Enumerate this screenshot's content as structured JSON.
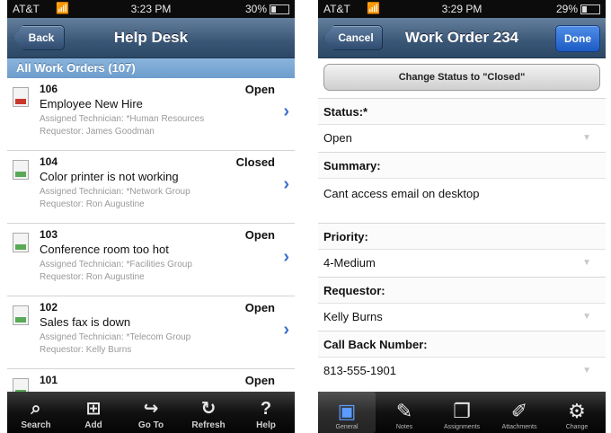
{
  "left": {
    "statusbar": {
      "carrier": "AT&T",
      "time": "3:23 PM",
      "battery": "30%"
    },
    "navbar": {
      "back": "Back",
      "title": "Help Desk"
    },
    "section": "All Work Orders (107)",
    "rows": [
      {
        "num": "106",
        "status": "Open",
        "summary": "Employee New Hire",
        "tech": "Assigned Technician: *Human Resources",
        "req": "Requestor: James Goodman"
      },
      {
        "num": "104",
        "status": "Closed",
        "summary": "Color printer is not working",
        "tech": "Assigned Technician: *Network Group",
        "req": "Requestor: Ron Augustine"
      },
      {
        "num": "103",
        "status": "Open",
        "summary": "Conference room too hot",
        "tech": "Assigned Technician: *Facilities Group",
        "req": "Requestor: Ron Augustine"
      },
      {
        "num": "102",
        "status": "Open",
        "summary": "Sales fax is down",
        "tech": "Assigned Technician: *Telecom Group",
        "req": "Requestor: Kelly Burns"
      },
      {
        "num": "101",
        "status": "Open",
        "summary": "",
        "tech": "",
        "req": ""
      }
    ],
    "tabs": [
      {
        "label": "Search",
        "icon": "search-icon"
      },
      {
        "label": "Add",
        "icon": "add-icon"
      },
      {
        "label": "Go To",
        "icon": "goto-icon"
      },
      {
        "label": "Refresh",
        "icon": "refresh-icon"
      },
      {
        "label": "Help",
        "icon": "help-icon"
      }
    ]
  },
  "right": {
    "statusbar": {
      "carrier": "AT&T",
      "time": "3:29 PM",
      "battery": "29%"
    },
    "navbar": {
      "cancel": "Cancel",
      "title": "Work Order 234",
      "done": "Done"
    },
    "change_status": "Change Status to \"Closed\"",
    "fields": {
      "status_label": "Status:*",
      "status_value": "Open",
      "summary_label": "Summary:",
      "summary_value": "Cant access email on desktop",
      "priority_label": "Priority:",
      "priority_value": "4-Medium",
      "requestor_label": "Requestor:",
      "requestor_value": "Kelly Burns",
      "callback_label": "Call Back Number:",
      "callback_value": "813-555-1901"
    },
    "tabs": [
      {
        "label": "General",
        "icon": "general-icon"
      },
      {
        "label": "Notes",
        "icon": "notes-icon"
      },
      {
        "label": "Assignments",
        "icon": "assignments-icon"
      },
      {
        "label": "Attachments",
        "icon": "paperclip-icon"
      },
      {
        "label": "Change",
        "icon": "change-icon"
      }
    ]
  }
}
